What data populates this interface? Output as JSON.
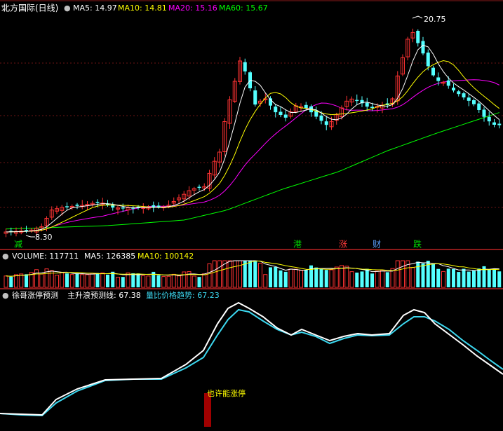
{
  "panel_main": {
    "stock_name": "北方国际(日线)",
    "ma5": "MA5: 14.97",
    "ma10": "MA10: 14.81",
    "ma20": "MA20: 15.16",
    "ma60": "MA60: 15.67",
    "high_label": "20.75",
    "low_label": "8.30"
  },
  "markers": [
    {
      "text": "减",
      "color": "#00e000"
    },
    {
      "text": "港",
      "color": "#00e000"
    },
    {
      "text": "涨",
      "color": "#ff3a3a"
    },
    {
      "text": "财",
      "color": "#5aa0ff"
    },
    {
      "text": "跌",
      "color": "#00e000"
    }
  ],
  "panel_volume": {
    "label": "VOLUME: 117711",
    "ma5": "MA5: 126385",
    "ma10": "MA10: 100142"
  },
  "panel_indicator": {
    "title": "徐哥涨停预测",
    "line1": "主升浪预测线: 67.38",
    "line2": "量比价格趋势: 67.23",
    "annotation": "也许能涨停"
  },
  "colors": {
    "up": "#ff3232",
    "down": "#54ffff",
    "ma5": "#ffffff",
    "ma10": "#ffff00",
    "ma20": "#ff00ff",
    "ma60": "#00ff00",
    "divider": "#8b1a1a",
    "ind_white": "#ffffff",
    "ind_cyan": "#3cd8f0",
    "annotation_bar": "#a00000",
    "annotation_text": "#ffff00"
  },
  "chart_data": [
    {
      "type": "candlestick",
      "title": "北方国际(日线)",
      "y_marks": {
        "high": 20.75,
        "low": 8.3
      },
      "series": [
        {
          "name": "MA5",
          "value": 14.97
        },
        {
          "name": "MA10",
          "value": 14.81
        },
        {
          "name": "MA20",
          "value": 15.16
        },
        {
          "name": "MA60",
          "value": 15.67
        }
      ]
    },
    {
      "type": "bar",
      "title": "VOLUME",
      "series": [
        {
          "name": "VOLUME",
          "value": 117711
        },
        {
          "name": "MA5",
          "value": 126385
        },
        {
          "name": "MA10",
          "value": 100142
        }
      ]
    },
    {
      "type": "line",
      "title": "徐哥涨停预测",
      "series": [
        {
          "name": "主升浪预测线",
          "value": 67.38
        },
        {
          "name": "量比价格趋势",
          "value": 67.23
        }
      ]
    }
  ]
}
